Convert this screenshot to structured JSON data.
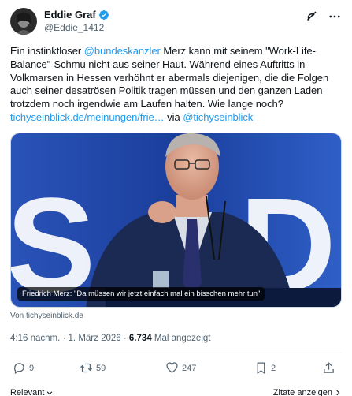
{
  "author": {
    "display_name": "Eddie Graf",
    "handle": "@Eddie_1412"
  },
  "tweet": {
    "text_1": "Ein instinktloser ",
    "mention_1": "@bundeskanzler",
    "text_2": " Merz kann mit seinem \"Work-Life-Balance\"-Schmu nicht aus seiner Haut. Während eines Auftritts in Volkmarsen in Hessen verhöhnt er abermals diejenigen, die die Folgen auch seiner desatrösen Politik tragen müssen und den ganzen Laden trotzdem noch irgendwie am Laufen halten. Wie lange noch?",
    "link_text": "tichyseinblick.de/meinungen/frie…",
    "text_3": " via ",
    "mention_2": "@tichyseinblick"
  },
  "media": {
    "caption": "Friedrich Merz: \"Da müssen wir jetzt einfach mal ein bisschen mehr tun\"",
    "source": "Von tichyseinblick.de"
  },
  "meta": {
    "time": "4:16 nachm.",
    "sep_1": " · ",
    "date": "1. März 2026",
    "sep_2": " · ",
    "views": "6.734",
    "views_label": " Mal angezeigt"
  },
  "actions": {
    "replies": "9",
    "reposts": "59",
    "likes": "247",
    "bookmarks": "2"
  },
  "footer": {
    "sort_label": "Relevant",
    "quotes_label": "Zitate anzeigen"
  },
  "icons": {
    "verified": "verified-badge-icon",
    "grok": "grok-icon",
    "more": "more-icon",
    "reply": "reply-icon",
    "repost": "repost-icon",
    "like": "like-icon",
    "bookmark": "bookmark-icon",
    "share": "share-icon"
  },
  "colors": {
    "accent": "#1d9bf0",
    "muted": "#536471",
    "text": "#0f1419"
  }
}
